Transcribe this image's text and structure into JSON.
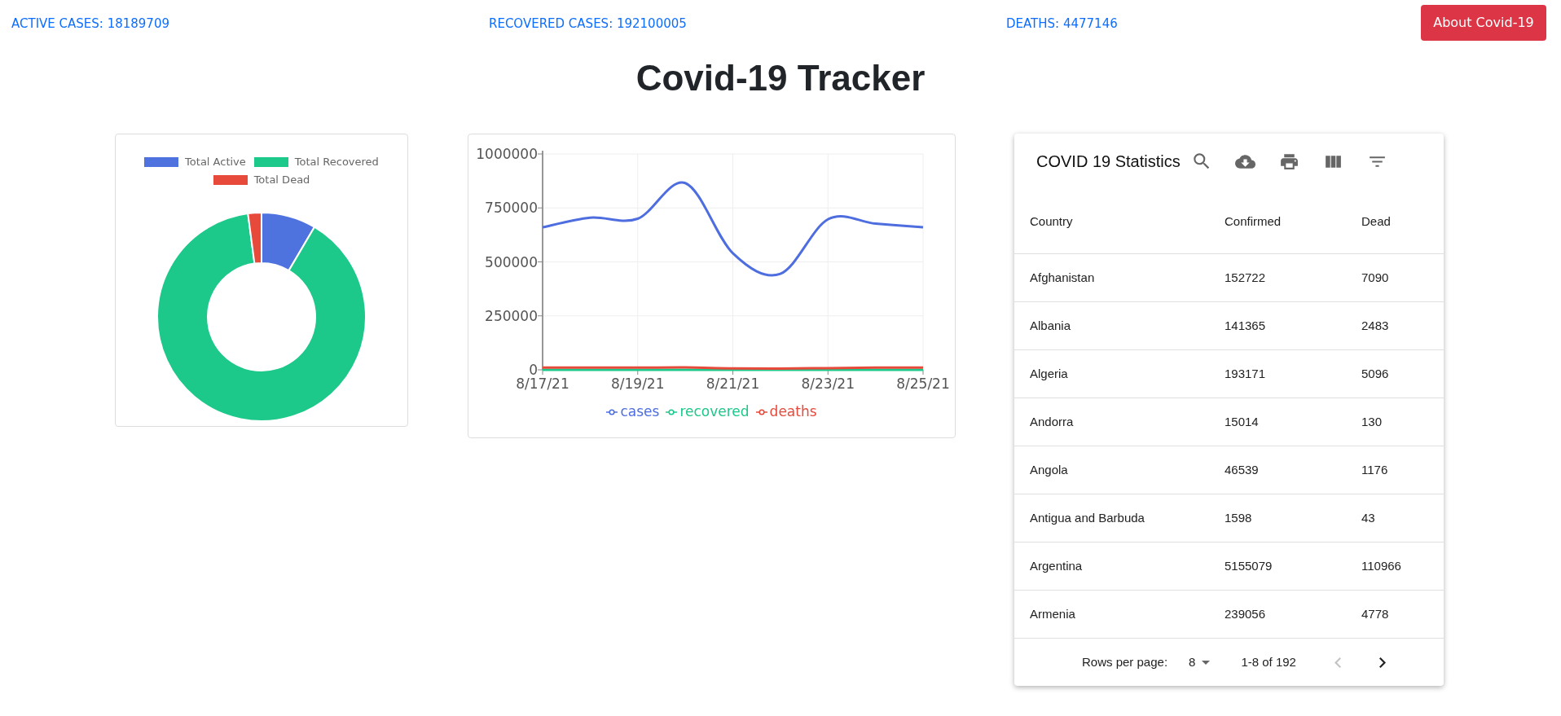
{
  "stats": [
    "ACTIVE CASES: 18189709",
    "RECOVERED CASES: 192100005",
    "DEATHS: 4477146"
  ],
  "about_button": "About Covid-19",
  "title": "Covid-19 Tracker",
  "donut_card": {
    "slices": [
      {
        "color": "#4e73df"
      },
      {
        "color": "#1cc88a"
      },
      {
        "color": "#e74a3b"
      }
    ],
    "chart_data": {
      "type": "donut",
      "categories": [
        "Total Active",
        "Total Recovered",
        "Total Dead"
      ],
      "values": [
        8.47,
        89.45,
        2.08
      ]
    }
  },
  "line_card": {
    "chart_data": {
      "type": "line",
      "categories": [
        "8/17/21",
        null,
        "8/19/21",
        null,
        "8/21/21",
        null,
        "8/23/21",
        null,
        "8/25/21"
      ],
      "ylim": [
        0,
        1000000
      ],
      "yticks": [
        0,
        250000,
        500000,
        750000,
        1000000
      ],
      "grid": true,
      "series": [
        {
          "name": "cases",
          "color": "#4e6ddf",
          "values": [
            660000,
            705000,
            700000,
            865000,
            540000,
            445000,
            697000,
            677000,
            660000
          ]
        },
        {
          "name": "recovered",
          "color": "#1cc88a",
          "values": [
            0,
            0,
            0,
            0,
            0,
            0,
            0,
            0,
            0
          ]
        },
        {
          "name": "deaths",
          "color": "#e74a3b",
          "values": [
            10000,
            10000,
            10000,
            11000,
            7000,
            6000,
            8000,
            10000,
            10000
          ]
        }
      ]
    }
  },
  "table": {
    "title": "COVID 19 Statistics",
    "columns": [
      "Country",
      "Confirmed",
      "Dead"
    ],
    "rows": [
      [
        "Afghanistan",
        "152722",
        "7090"
      ],
      [
        "Albania",
        "141365",
        "2483"
      ],
      [
        "Algeria",
        "193171",
        "5096"
      ],
      [
        "Andorra",
        "15014",
        "130"
      ],
      [
        "Angola",
        "46539",
        "1176"
      ],
      [
        "Antigua and Barbuda",
        "1598",
        "43"
      ],
      [
        "Argentina",
        "5155079",
        "110966"
      ],
      [
        "Armenia",
        "239056",
        "4778"
      ]
    ],
    "pagination": {
      "rows_per_page_label": "Rows per page:",
      "rows_per_page": "8",
      "range": "1-8 of 192",
      "previous_disabled": true,
      "next_disabled": false
    }
  }
}
